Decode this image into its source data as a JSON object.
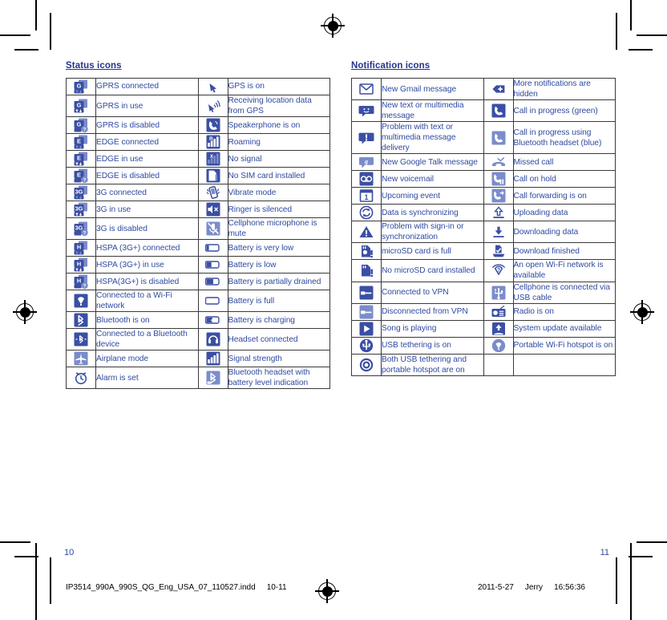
{
  "document": {
    "left_page_number": "10",
    "right_page_number": "11",
    "slug_filename": "IP3514_990A_990S_QG_Eng_USA_07_110527.indd",
    "slug_page_range": "10-11",
    "slug_date": "2011-5-27",
    "slug_operator": "Jerry",
    "slug_time": "16:56:36"
  },
  "colors": {
    "heading": "#25348b",
    "body_text": "#2f4aa0",
    "icon_blue": "#3b4fa4",
    "icon_blue_light": "#7b8ccb",
    "table_border": "#3a3a3a"
  },
  "status_section": {
    "title": "Status icons",
    "rows": [
      {
        "left_icon": "gprs-connected-icon",
        "left_label": "GPRS connected",
        "right_icon": "gps-on-icon",
        "right_label": "GPS is on"
      },
      {
        "left_icon": "gprs-in-use-icon",
        "left_label": "GPRS in use",
        "right_icon": "gps-receiving-icon",
        "right_label": "Receiving location data from GPS"
      },
      {
        "left_icon": "gprs-disabled-icon",
        "left_label": "GPRS is disabled",
        "right_icon": "speakerphone-on-icon",
        "right_label": "Speakerphone is on"
      },
      {
        "left_icon": "edge-connected-icon",
        "left_label": "EDGE connected",
        "right_icon": "roaming-icon",
        "right_label": "Roaming"
      },
      {
        "left_icon": "edge-in-use-icon",
        "left_label": "EDGE in use",
        "right_icon": "no-signal-icon",
        "right_label": "No signal"
      },
      {
        "left_icon": "edge-disabled-icon",
        "left_label": "EDGE is disabled",
        "right_icon": "no-sim-card-icon",
        "right_label": "No SIM card installed"
      },
      {
        "left_icon": "3g-connected-icon",
        "left_label": "3G connected",
        "right_icon": "vibrate-mode-icon",
        "right_label": "Vibrate mode"
      },
      {
        "left_icon": "3g-in-use-icon",
        "left_label": "3G in use",
        "right_icon": "ringer-silenced-icon",
        "right_label": "Ringer is silenced"
      },
      {
        "left_icon": "3g-disabled-icon",
        "left_label": "3G is disabled",
        "right_icon": "microphone-mute-icon",
        "right_label": "Cellphone microphone is mute"
      },
      {
        "left_icon": "hspa-connected-icon",
        "left_label": "HSPA (3G+) connected",
        "right_icon": "battery-very-low-icon",
        "right_label": "Battery is very low"
      },
      {
        "left_icon": "hspa-in-use-icon",
        "left_label": "HSPA (3G+) in use",
        "right_icon": "battery-low-icon",
        "right_label": "Battery is low"
      },
      {
        "left_icon": "hspa-disabled-icon",
        "left_label": "HSPA(3G+) is disabled",
        "right_icon": "battery-partial-icon",
        "right_label": "Battery is partially drained"
      },
      {
        "left_icon": "wifi-connected-icon",
        "left_label": "Connected to a Wi-Fi network",
        "right_icon": "battery-full-icon",
        "right_label": "Battery is full"
      },
      {
        "left_icon": "bluetooth-on-icon",
        "left_label": "Bluetooth is on",
        "right_icon": "battery-charging-icon",
        "right_label": "Battery is charging"
      },
      {
        "left_icon": "bluetooth-connected-icon",
        "left_label": "Connected to a Bluetooth device",
        "right_icon": "headset-connected-icon",
        "right_label": "Headset connected"
      },
      {
        "left_icon": "airplane-mode-icon",
        "left_label": "Airplane mode",
        "right_icon": "signal-strength-icon",
        "right_label": "Signal strength"
      },
      {
        "left_icon": "alarm-set-icon",
        "left_label": "Alarm is set",
        "right_icon": "bluetooth-headset-battery-icon",
        "right_label": "Bluetooth headset with battery level indication"
      }
    ]
  },
  "notification_section": {
    "title": "Notification icons",
    "rows": [
      {
        "left_icon": "new-gmail-icon",
        "left_label": "New Gmail message",
        "right_icon": "more-notifications-icon",
        "right_label": "More notifications are hidden"
      },
      {
        "left_icon": "new-sms-icon",
        "left_label": "New text or multimedia message",
        "right_icon": "call-in-progress-icon",
        "right_label": "Call in progress (green)"
      },
      {
        "left_icon": "sms-problem-icon",
        "left_label": "Problem with text or multimedia message delivery",
        "right_icon": "call-bluetooth-icon",
        "right_label": "Call in progress using Bluetooth headset (blue)"
      },
      {
        "left_icon": "google-talk-icon",
        "left_label": "New Google Talk message",
        "right_icon": "missed-call-icon",
        "right_label": "Missed call"
      },
      {
        "left_icon": "new-voicemail-icon",
        "left_label": "New voicemail",
        "right_icon": "call-on-hold-icon",
        "right_label": "Call on hold"
      },
      {
        "left_icon": "upcoming-event-icon",
        "left_label": "Upcoming event",
        "right_icon": "call-forwarding-icon",
        "right_label": "Call forwarding is on"
      },
      {
        "left_icon": "data-sync-icon",
        "left_label": "Data is synchronizing",
        "right_icon": "upload-icon",
        "right_label": "Uploading data"
      },
      {
        "left_icon": "sync-problem-icon",
        "left_label": "Problem with sign-in or synchronization",
        "right_icon": "download-icon",
        "right_label": "Downloading data"
      },
      {
        "left_icon": "sdcard-full-icon",
        "left_label": "microSD card is full",
        "right_icon": "download-finished-icon",
        "right_label": "Download finished"
      },
      {
        "left_icon": "no-sdcard-icon",
        "left_label": "No microSD card installed",
        "right_icon": "open-wifi-icon",
        "right_label": "An open Wi-Fi network is available"
      },
      {
        "left_icon": "vpn-connected-icon",
        "left_label": "Connected to VPN",
        "right_icon": "usb-connected-icon",
        "right_label": "Cellphone is connected via USB cable"
      },
      {
        "left_icon": "vpn-disconnected-icon",
        "left_label": "Disconnected from VPN",
        "right_icon": "radio-on-icon",
        "right_label": "Radio is on"
      },
      {
        "left_icon": "song-playing-icon",
        "left_label": "Song is playing",
        "right_icon": "system-update-icon",
        "right_label": "System update available"
      },
      {
        "left_icon": "usb-tethering-icon",
        "left_label": "USB tethering is on",
        "right_icon": "portable-hotspot-icon",
        "right_label": "Portable Wi-Fi hotspot is on"
      },
      {
        "left_icon": "tethering-and-hotspot-icon",
        "left_label": "Both USB tethering and portable hotspot are on",
        "right_icon": "",
        "right_label": ""
      }
    ]
  }
}
